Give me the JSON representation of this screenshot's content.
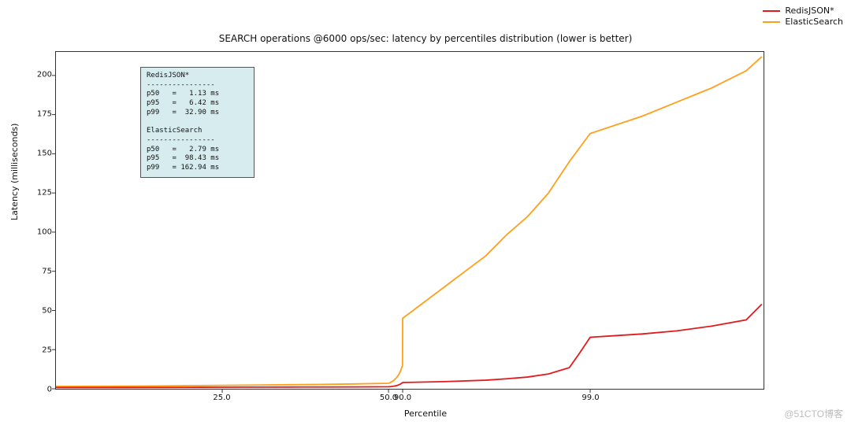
{
  "chart_data": {
    "type": "line",
    "title": "SEARCH operations @6000 ops/sec: latency by percentiles distribution (lower is better)",
    "xlabel": "Percentile",
    "ylabel": "Latency (milliseconds)",
    "ylim": [
      0,
      215
    ],
    "xticks": [
      "25.0",
      "50.0",
      "90.0",
      "99.0"
    ],
    "yticks": [
      0,
      25,
      50,
      75,
      100,
      125,
      150,
      175,
      200
    ],
    "series": [
      {
        "name": "RedisJSON*",
        "color": "#e31a1c",
        "x": [
          0,
          5,
          10,
          15,
          20,
          25,
          30,
          35,
          40,
          45,
          50,
          55,
          60,
          65,
          70,
          75,
          80,
          85,
          90,
          92,
          94,
          95,
          96,
          97,
          98,
          98.5,
          99,
          99.3,
          99.5,
          99.7,
          99.9,
          99.99
        ],
        "y": [
          0.8,
          0.8,
          0.85,
          0.9,
          0.95,
          1.0,
          1.05,
          1.1,
          1.13,
          1.2,
          1.3,
          1.4,
          1.5,
          1.7,
          1.9,
          2.2,
          2.6,
          3.2,
          4.0,
          4.6,
          5.5,
          6.42,
          7.5,
          9.5,
          13.5,
          23,
          32.9,
          35,
          37,
          40,
          44,
          54
        ]
      },
      {
        "name": "ElasticSearch",
        "color": "#ff9f1a",
        "x": [
          0,
          5,
          10,
          15,
          20,
          25,
          30,
          35,
          40,
          45,
          50,
          55,
          60,
          65,
          70,
          75,
          80,
          85,
          88,
          89.5,
          90,
          91,
          92,
          93,
          94,
          95,
          96,
          97,
          98,
          99,
          99.3,
          99.5,
          99.7,
          99.9,
          99.99
        ],
        "y": [
          1.5,
          1.6,
          1.7,
          1.8,
          2.0,
          2.2,
          2.4,
          2.6,
          2.79,
          3.1,
          3.5,
          4.0,
          4.6,
          5.4,
          6.5,
          7.8,
          9.5,
          12,
          14,
          15,
          45,
          55,
          65,
          75,
          85,
          98.43,
          110,
          125,
          145,
          162.94,
          174,
          183,
          192,
          203,
          212
        ]
      }
    ],
    "legend": [
      "RedisJSON*",
      "ElasticSearch"
    ],
    "stats_box": {
      "redis": {
        "label": "RedisJSON*",
        "p50": "1.13 ms",
        "p95": "6.42 ms",
        "p99": "32.90 ms"
      },
      "es": {
        "label": "ElasticSearch",
        "p50": "2.79 ms",
        "p95": "98.43 ms",
        "p99": "162.94 ms"
      }
    }
  },
  "watermark": "@51CTO博客"
}
